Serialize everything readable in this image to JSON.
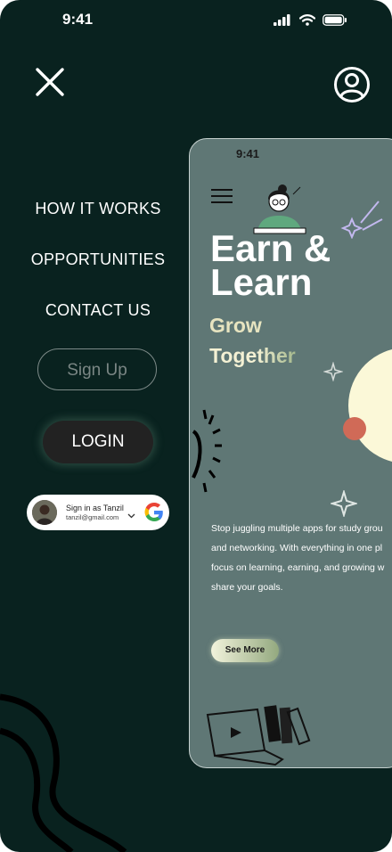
{
  "status_bar": {
    "time": "9:41"
  },
  "nav": {
    "close_icon": "close-icon",
    "profile_icon": "user-circle-icon"
  },
  "menu": {
    "items": [
      {
        "label": "HOW IT WORKS"
      },
      {
        "label": "OPPORTUNITIES"
      },
      {
        "label": "CONTACT US"
      }
    ],
    "signup_label": "Sign Up",
    "login_label": "LOGIN"
  },
  "google_signin": {
    "title": "Sign in as Tanzil",
    "email": "tanzil@gmail.com"
  },
  "preview": {
    "time": "9:41",
    "title_line1": "Earn &",
    "title_line2": "Learn",
    "subtitle_line1": "Grow",
    "subtitle_line2": "Together",
    "body_lines": [
      "Stop juggling multiple apps for study grou",
      "and networking. With everything in one pl",
      "focus on learning, earning, and growing w",
      "share your goals."
    ],
    "see_more_label": "See More"
  },
  "colors": {
    "background": "#09221f",
    "preview_background": "#5f7775",
    "login_button": "#222222",
    "accent_orange": "#d06a57",
    "accent_cream": "#fbf8d8"
  }
}
